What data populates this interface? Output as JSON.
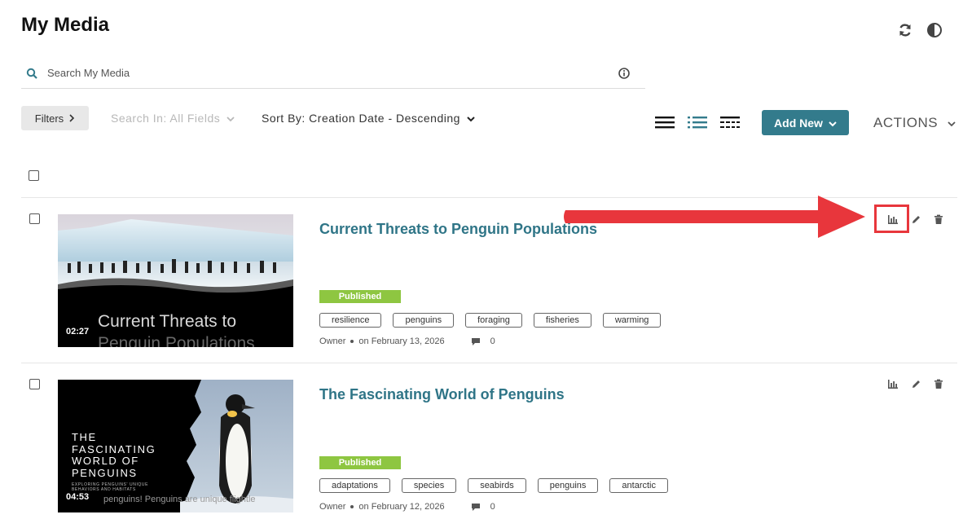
{
  "page": {
    "title": "My Media"
  },
  "search": {
    "placeholder": "Search My Media",
    "value": ""
  },
  "toolbar": {
    "filters_label": "Filters",
    "search_in_label": "Search In: All Fields",
    "sort_by_label": "Sort By: Creation Date - Descending",
    "add_new_label": "Add New",
    "actions_label": "ACTIONS"
  },
  "colors": {
    "accent": "#337b8c",
    "title_link": "#2f7587",
    "published": "#8ec641",
    "highlight": "#e8363c"
  },
  "entries": [
    {
      "title": "Current Threats to Penguin Populations",
      "duration": "02:27",
      "thumb_caption_1": "Current Threats to",
      "thumb_caption_2": "Penguin Populations",
      "status": "Published",
      "tags": [
        "resilience",
        "penguins",
        "foraging",
        "fisheries",
        "warming"
      ],
      "owner": "Owner",
      "date": "on February 13, 2026",
      "comments": "0"
    },
    {
      "title": "The Fascinating World of Penguins",
      "duration": "04:53",
      "thumb_title": [
        "THE",
        "FASCINATING",
        "WORLD OF",
        "PENGUINS"
      ],
      "thumb_subtitle_1": "EXPLORING PENGUINS' UNIQUE",
      "thumb_subtitle_2": "BEHAVIORS AND HABITATS",
      "thumb_caption": "penguins! Penguins are unique flightle",
      "status": "Published",
      "tags": [
        "adaptations",
        "species",
        "seabirds",
        "penguins",
        "antarctic"
      ],
      "owner": "Owner",
      "date": "on February 12, 2026",
      "comments": "0"
    }
  ]
}
